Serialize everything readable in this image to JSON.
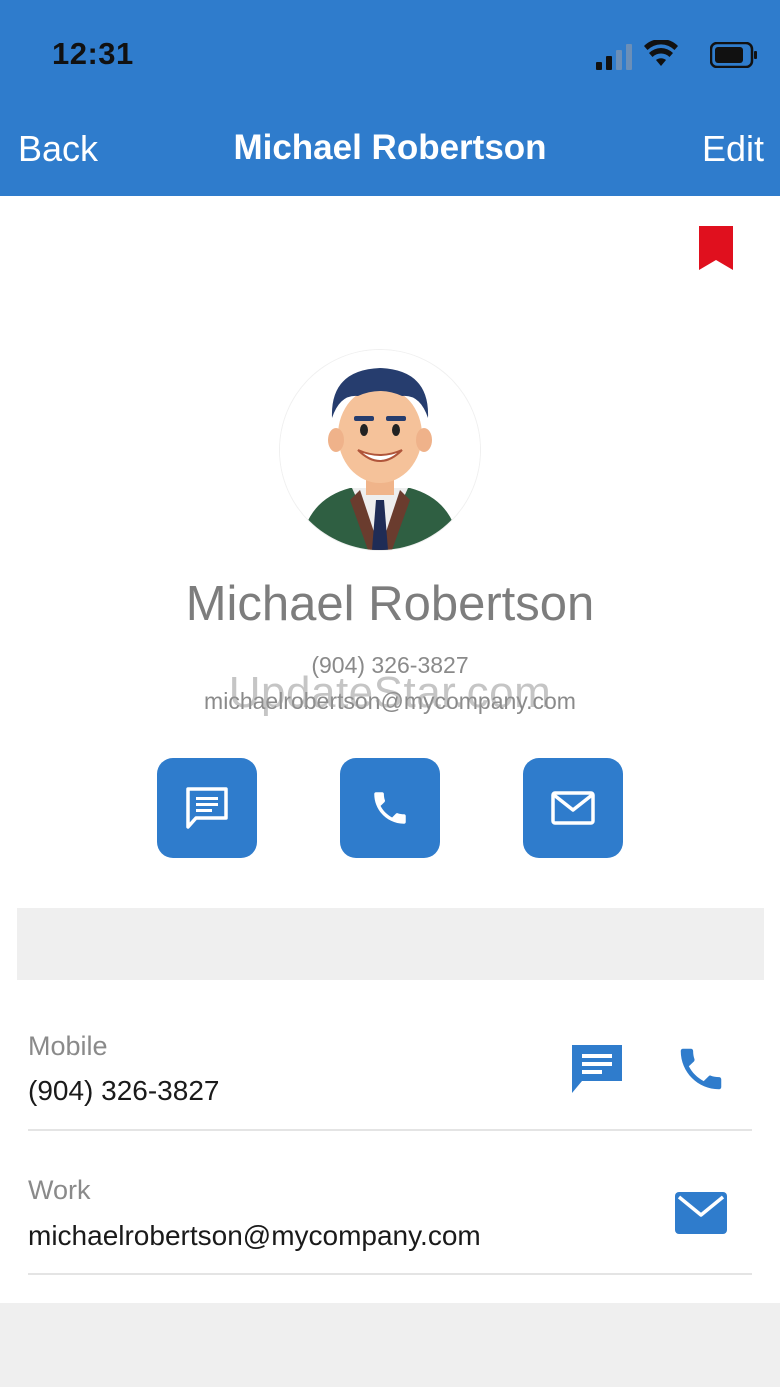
{
  "status_bar": {
    "time": "12:31"
  },
  "nav": {
    "back_label": "Back",
    "title": "Michael Robertson",
    "edit_label": "Edit"
  },
  "profile": {
    "name": "Michael Robertson",
    "phone": "(904) 326-3827",
    "email": "michaelrobertson@mycompany.com"
  },
  "watermark": "UpdateStar.com",
  "details": [
    {
      "label": "Mobile",
      "value": "(904) 326-3827"
    },
    {
      "label": "Work",
      "value": "michaelrobertson@mycompany.com"
    }
  ],
  "colors": {
    "accent": "#2f7ccc",
    "bookmark": "#e0101e"
  },
  "icons": [
    "signal-icon",
    "wifi-icon",
    "battery-icon",
    "bookmark-icon",
    "message-icon",
    "phone-icon",
    "mail-icon"
  ]
}
